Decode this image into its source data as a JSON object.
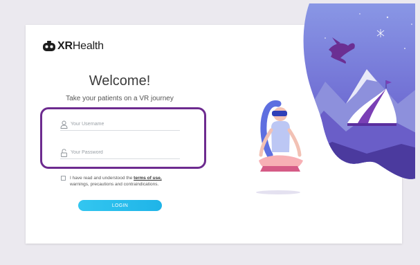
{
  "brand": {
    "logo_bold": "XR",
    "logo_light": "Health",
    "logo_icon": "vr-headset-icon"
  },
  "login": {
    "welcome": "Welcome!",
    "tagline": "Take your patients on a VR journey",
    "username": {
      "placeholder": "Your Username",
      "value": "",
      "icon": "user-icon"
    },
    "password": {
      "placeholder": "Your Password",
      "value": "",
      "icon": "lock-icon"
    },
    "terms": {
      "prefix": "I have read and understood the",
      "link": "terms of use,",
      "suffix": "warnings, precautions and contraindications."
    },
    "button_label": "LOGIN"
  },
  "colors": {
    "accent": "#22b8ea",
    "highlight_border": "#6d2b8f",
    "illustration_dark": "#4a3fae",
    "illustration_light": "#7e8bdb"
  }
}
